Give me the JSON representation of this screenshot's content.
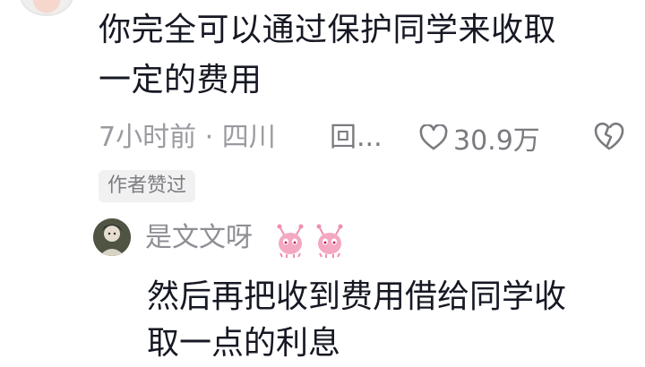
{
  "comment": {
    "text_line1": "你完全可以通过保护同学来收取",
    "text_line2": "一定的费用",
    "time_location": "7小时前 · 四川",
    "reply_label": "回...",
    "like_count": "30.9万",
    "author_badge": "作者赞过"
  },
  "reply": {
    "username": "是文文呀",
    "text_line1": "然后再把收到费用借给同学收",
    "text_line2": "取一点的利息"
  },
  "icons": {
    "like": "heart-outline-icon",
    "dislike": "broken-heart-icon",
    "emoji": "pink-bug-emoji-icon"
  },
  "colors": {
    "text_primary": "#161823",
    "text_secondary": "#9a9ba0",
    "badge_bg": "#f1f1f2",
    "emoji_pink": "#f4a8c2"
  }
}
